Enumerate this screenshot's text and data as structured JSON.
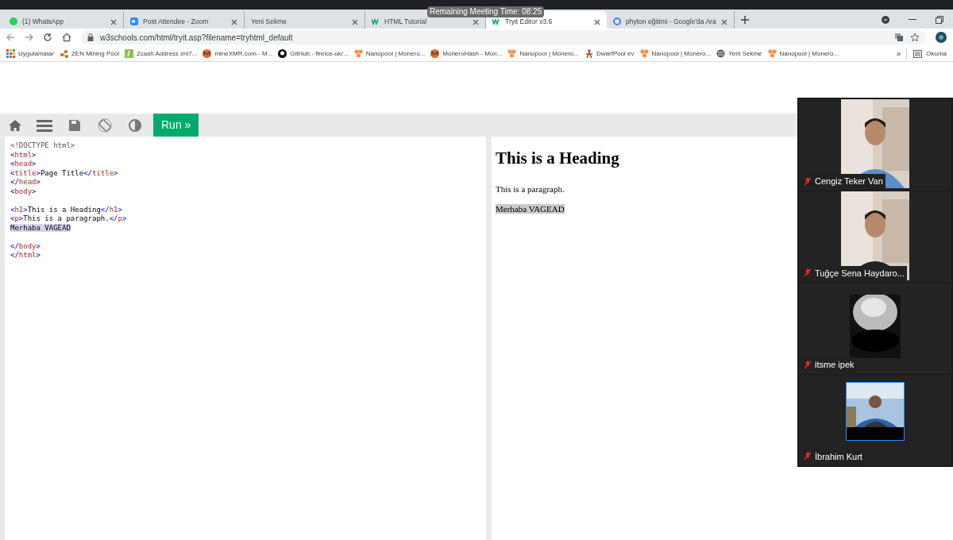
{
  "browser": {
    "tabs": [
      {
        "title": "(1) WhatsApp",
        "selected": false
      },
      {
        "title": "Post Attendee - Zoom",
        "selected": false
      },
      {
        "title": "Yeni Sekme",
        "selected": false
      },
      {
        "title": "HTML Tutorial",
        "selected": false
      },
      {
        "title": "Tryit Editor v3.6",
        "selected": true
      },
      {
        "title": "phyton eğitimi - Google'da Ara",
        "selected": false
      }
    ],
    "url": "w3schools.com/html/tryit.asp?filename=tryhtml_default",
    "bookmarks": [
      {
        "title": "Uygulamalar"
      },
      {
        "title": "ZEN Mining Pool"
      },
      {
        "title": "Zcash Address zni7..."
      },
      {
        "title": "mineXMR.com - M..."
      },
      {
        "title": "GitHub - fireice-uk/..."
      },
      {
        "title": "Nanopool | Monero..."
      },
      {
        "title": "MoneroHash - Mon..."
      },
      {
        "title": "Nanopool | Monero..."
      },
      {
        "title": "DwarfPool ev"
      },
      {
        "title": "Nanopool | Monero..."
      },
      {
        "title": "Yeni Sekme"
      },
      {
        "title": "Nanopool | Monero..."
      }
    ],
    "overflow": "»",
    "reading_list": "Okuma"
  },
  "tryit": {
    "run_button": "Run »",
    "code_lines": [
      {
        "highlighted": false,
        "tokens": [
          {
            "kind": "doctype",
            "text": "<!DOCTYPE html>"
          }
        ]
      },
      {
        "highlighted": false,
        "tokens": [
          {
            "kind": "punct",
            "text": "<"
          },
          {
            "kind": "tag",
            "text": "html"
          },
          {
            "kind": "punct",
            "text": ">"
          }
        ]
      },
      {
        "highlighted": false,
        "tokens": [
          {
            "kind": "punct",
            "text": "<"
          },
          {
            "kind": "tag",
            "text": "head"
          },
          {
            "kind": "punct",
            "text": ">"
          }
        ]
      },
      {
        "highlighted": false,
        "tokens": [
          {
            "kind": "punct",
            "text": "<"
          },
          {
            "kind": "tag",
            "text": "title"
          },
          {
            "kind": "punct",
            "text": ">"
          },
          {
            "kind": "text",
            "text": "Page Title"
          },
          {
            "kind": "punct",
            "text": "</"
          },
          {
            "kind": "tag",
            "text": "title"
          },
          {
            "kind": "punct",
            "text": ">"
          }
        ]
      },
      {
        "highlighted": false,
        "tokens": [
          {
            "kind": "punct",
            "text": "</"
          },
          {
            "kind": "tag",
            "text": "head"
          },
          {
            "kind": "punct",
            "text": ">"
          }
        ]
      },
      {
        "highlighted": false,
        "tokens": [
          {
            "kind": "punct",
            "text": "<"
          },
          {
            "kind": "tag",
            "text": "body"
          },
          {
            "kind": "punct",
            "text": ">"
          }
        ]
      },
      {
        "highlighted": false
      },
      {
        "highlighted": false,
        "tokens": [
          {
            "kind": "punct",
            "text": "<"
          },
          {
            "kind": "tag",
            "text": "h1"
          },
          {
            "kind": "punct",
            "text": ">"
          },
          {
            "kind": "text",
            "text": "This is a Heading"
          },
          {
            "kind": "punct",
            "text": "</"
          },
          {
            "kind": "tag",
            "text": "h1"
          },
          {
            "kind": "punct",
            "text": ">"
          }
        ]
      },
      {
        "highlighted": false,
        "tokens": [
          {
            "kind": "punct",
            "text": "<"
          },
          {
            "kind": "tag",
            "text": "p"
          },
          {
            "kind": "punct",
            "text": ">"
          },
          {
            "kind": "text",
            "text": "This is a paragraph."
          },
          {
            "kind": "punct",
            "text": "</"
          },
          {
            "kind": "tag",
            "text": "p"
          },
          {
            "kind": "punct",
            "text": ">"
          }
        ]
      },
      {
        "highlighted": true,
        "tokens": [
          {
            "kind": "text",
            "text": "Merhaba VAGEAD"
          }
        ]
      },
      {
        "highlighted": false
      },
      {
        "highlighted": false,
        "tokens": [
          {
            "kind": "punct",
            "text": "</"
          },
          {
            "kind": "tag",
            "text": "body"
          },
          {
            "kind": "punct",
            "text": ">"
          }
        ]
      },
      {
        "highlighted": false,
        "tokens": [
          {
            "kind": "punct",
            "text": "</"
          },
          {
            "kind": "tag",
            "text": "html"
          },
          {
            "kind": "punct",
            "text": ">"
          }
        ]
      }
    ],
    "result": {
      "heading": "This is a Heading",
      "paragraph": "This is a paragraph.",
      "selected_text": "Merhaba VAGEAD"
    }
  },
  "meeting": {
    "remaining_time": "Remaining Meeting Time: 08:25",
    "participants": [
      {
        "name": "Cengiz Teker Van",
        "muted": true
      },
      {
        "name": "Tuğçe Sena Haydaro...",
        "muted": true
      },
      {
        "name": "itsme ipek",
        "muted": true
      },
      {
        "name": "İbrahim Kurt",
        "muted": true
      }
    ]
  }
}
